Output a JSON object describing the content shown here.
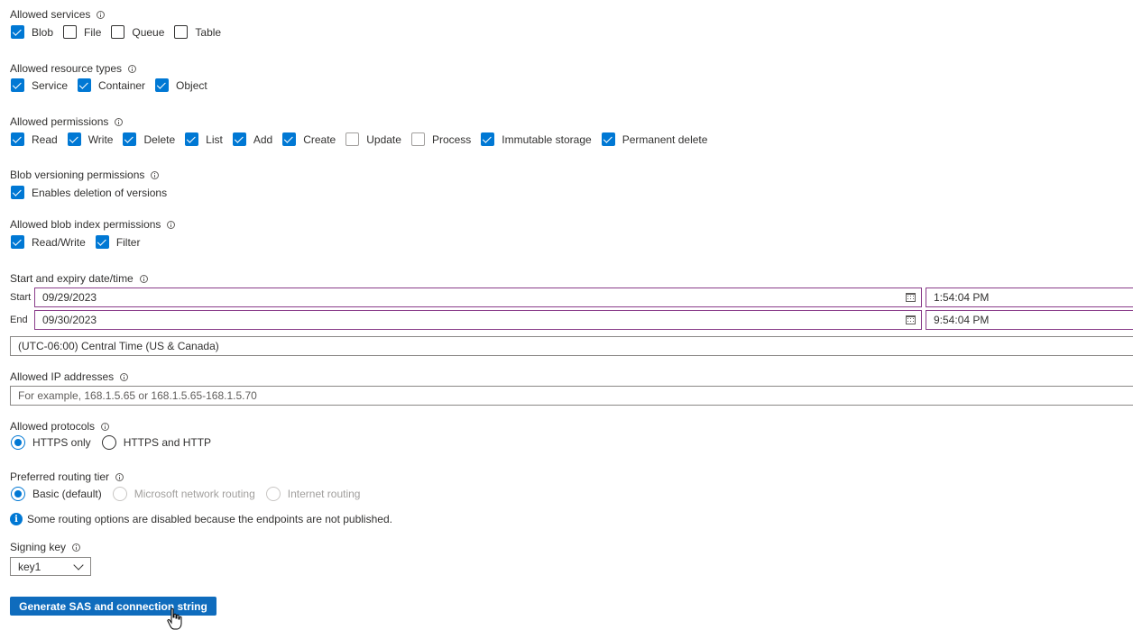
{
  "allowed_services": {
    "label": "Allowed services",
    "options": [
      {
        "label": "Blob",
        "checked": true
      },
      {
        "label": "File",
        "checked": false
      },
      {
        "label": "Queue",
        "checked": false
      },
      {
        "label": "Table",
        "checked": false
      }
    ]
  },
  "allowed_resource_types": {
    "label": "Allowed resource types",
    "options": [
      {
        "label": "Service",
        "checked": true
      },
      {
        "label": "Container",
        "checked": true
      },
      {
        "label": "Object",
        "checked": true
      }
    ]
  },
  "allowed_permissions": {
    "label": "Allowed permissions",
    "options": [
      {
        "label": "Read",
        "checked": true
      },
      {
        "label": "Write",
        "checked": true
      },
      {
        "label": "Delete",
        "checked": true
      },
      {
        "label": "List",
        "checked": true
      },
      {
        "label": "Add",
        "checked": true
      },
      {
        "label": "Create",
        "checked": true
      },
      {
        "label": "Update",
        "checked": false
      },
      {
        "label": "Process",
        "checked": false
      },
      {
        "label": "Immutable storage",
        "checked": true
      },
      {
        "label": "Permanent delete",
        "checked": true
      }
    ]
  },
  "blob_versioning": {
    "label": "Blob versioning permissions",
    "options": [
      {
        "label": "Enables deletion of versions",
        "checked": true
      }
    ]
  },
  "blob_index": {
    "label": "Allowed blob index permissions",
    "options": [
      {
        "label": "Read/Write",
        "checked": true
      },
      {
        "label": "Filter",
        "checked": true
      }
    ]
  },
  "datetime": {
    "label": "Start and expiry date/time",
    "start_label": "Start",
    "start_date": "09/29/2023",
    "start_time": "1:54:04 PM",
    "end_label": "End",
    "end_date": "09/30/2023",
    "end_time": "9:54:04 PM",
    "timezone": "(UTC-06:00) Central Time (US & Canada)"
  },
  "ip": {
    "label": "Allowed IP addresses",
    "placeholder": "For example, 168.1.5.65 or 168.1.5.65-168.1.5.70",
    "value": ""
  },
  "protocols": {
    "label": "Allowed protocols",
    "options": [
      {
        "label": "HTTPS only",
        "selected": true
      },
      {
        "label": "HTTPS and HTTP",
        "selected": false
      }
    ]
  },
  "routing": {
    "label": "Preferred routing tier",
    "options": [
      {
        "label": "Basic (default)",
        "selected": true,
        "disabled": false
      },
      {
        "label": "Microsoft network routing",
        "selected": false,
        "disabled": true
      },
      {
        "label": "Internet routing",
        "selected": false,
        "disabled": true
      }
    ],
    "notice": "Some routing options are disabled because the endpoints are not published."
  },
  "signing_key": {
    "label": "Signing key",
    "value": "key1"
  },
  "generate_button": "Generate SAS and connection string",
  "colors": {
    "accent": "#0078d4",
    "button": "#0f6cbd",
    "date_border": "#8a3d8a"
  }
}
